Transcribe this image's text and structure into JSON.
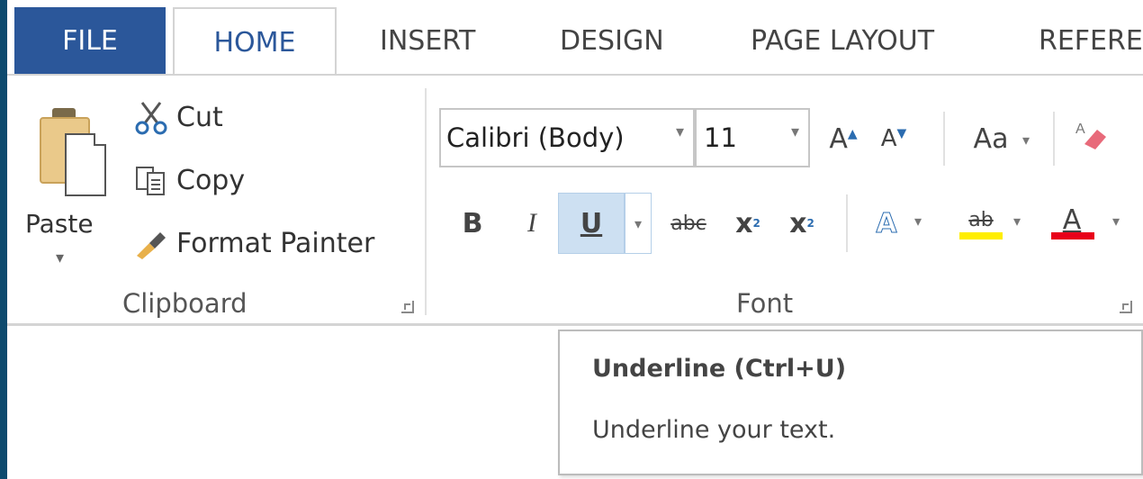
{
  "tabs": {
    "file": "FILE",
    "items": [
      {
        "label": "HOME"
      },
      {
        "label": "INSERT"
      },
      {
        "label": "DESIGN"
      },
      {
        "label": "PAGE LAYOUT"
      },
      {
        "label": "REFERE"
      }
    ],
    "active": "HOME"
  },
  "clipboard": {
    "paste_label": "Paste",
    "cut_label": "Cut",
    "copy_label": "Copy",
    "format_painter_label": "Format Painter",
    "group_label": "Clipboard"
  },
  "font": {
    "font_name": "Calibri (Body)",
    "font_size": "11",
    "change_case_label": "Aa",
    "bold_label": "B",
    "italic_label": "I",
    "underline_label": "U",
    "strikethrough_label": "abc",
    "subscript_label": "x",
    "superscript_label": "x",
    "text_effects_label": "A",
    "highlight_label": "ab",
    "font_color_label": "A",
    "group_label": "Font",
    "highlight_color": "#ffee00",
    "font_color": "#e8001a",
    "selected_button": "underline"
  },
  "tooltip": {
    "title": "Underline (Ctrl+U)",
    "description": "Underline your text."
  },
  "colors": {
    "window_border": "#0d4a6e",
    "file_tab": "#2b579a",
    "active_tab_text": "#2b579a",
    "button_highlight": "#cde0f2"
  }
}
